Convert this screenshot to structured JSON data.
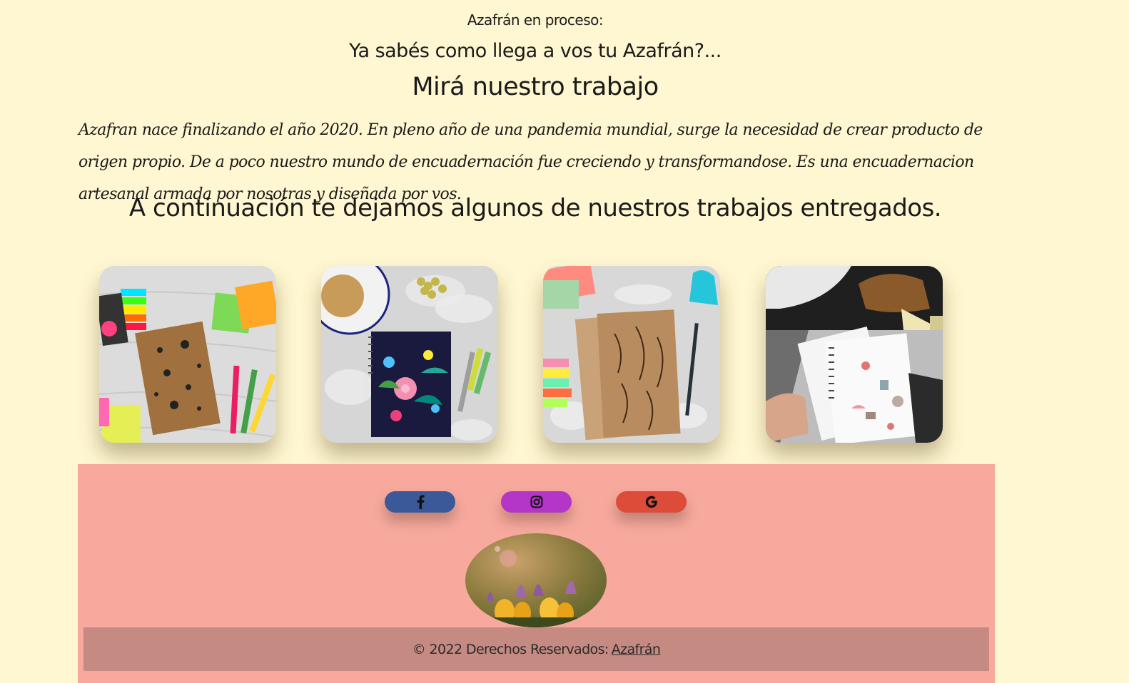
{
  "header": {
    "top_title": "Azafrán en proceso:",
    "subtitle": "Ya sabés como llega a vos tu Azafrán?...",
    "heading": "Mirá nuestro trabajo"
  },
  "intro": {
    "text": "Azafran nace finalizando el año 2020. En pleno año de una pandemia mundial, surge la necesidad de crear producto de origen propio. De a poco nuestro mundo de encuadernación fue creciendo y transformandose. Es una encuadernacion artesanal armada por nosotras y diseñada por vos."
  },
  "gallery": {
    "intro": "A continuación te dejamos algunos de nuestros trabajos entregados."
  },
  "footer": {
    "social": [
      {
        "name": "facebook",
        "icon": "facebook-icon",
        "color": "#3b5998"
      },
      {
        "name": "instagram",
        "icon": "instagram-icon",
        "color": "#b336c8"
      },
      {
        "name": "google",
        "icon": "google-icon",
        "color": "#dd4b39"
      }
    ],
    "copyright_prefix": "© 2022 Derechos Reservados:",
    "copyright_link": "Azafrán"
  },
  "colors": {
    "page_background": "#fff7d1",
    "footer_background": "#f7a99d",
    "copyright_bar": "#c58a82"
  }
}
